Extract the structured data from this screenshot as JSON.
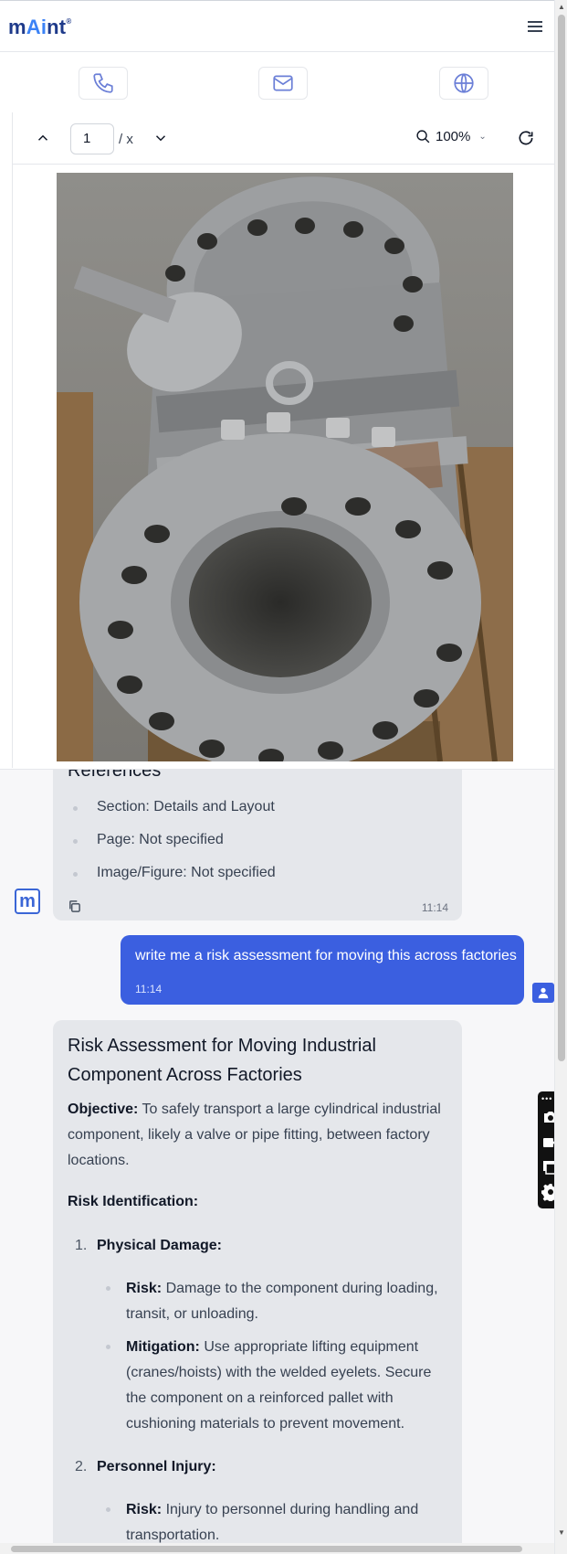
{
  "header": {
    "logo_prefix": "m",
    "logo_ai": "Ai",
    "logo_suffix": "nt",
    "logo_mark": "®",
    "menu_icon": "hamburger-icon"
  },
  "contact": {
    "icons": [
      "phone-icon",
      "mail-icon",
      "globe-icon"
    ]
  },
  "viewer": {
    "page_value": "1",
    "page_total": "/ x",
    "zoom": "100%",
    "colors": {
      "accent": "#3b5fe0"
    }
  },
  "chat": {
    "message1": {
      "heading_partial": "References",
      "items": [
        "Section: Details and Layout",
        "Page: Not specified",
        "Image/Figure: Not specified"
      ],
      "time": "11:14"
    },
    "user_message": {
      "text": "write me a risk assessment for moving this across factories",
      "time": "11:14"
    },
    "message2": {
      "title": "Risk Assessment for Moving Industrial Component Across Factories",
      "objective_label": "Objective:",
      "objective_text": " To safely transport a large cylindrical industrial component, likely a valve or pipe fitting, between factory locations.",
      "risk_id_label": "Risk Identification:",
      "item1_num": "1.",
      "item1_label": "Physical Damage:",
      "item1_risk_label": "Risk:",
      "item1_risk_text": " Damage to the component during loading, transit, or unloading.",
      "item1_mit_label": "Mitigation:",
      "item1_mit_text": " Use appropriate lifting equipment (cranes/hoists) with the welded eyelets. Secure the component on a reinforced pallet with cushioning materials to prevent movement.",
      "item2_num": "2.",
      "item2_label": "Personnel Injury:",
      "item2_risk_label": "Risk:",
      "item2_risk_text": " Injury to personnel during handling and transportation."
    },
    "bot_avatar": "m"
  }
}
